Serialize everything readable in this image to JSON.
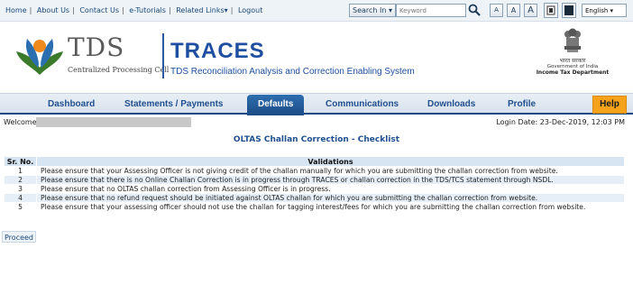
{
  "top_links": [
    "Home",
    "About Us",
    "Contact Us",
    "e-Tutorials",
    "Related Links▾",
    "Logout"
  ],
  "search": {
    "button_label": "Search In ▾",
    "placeholder": "Keyword"
  },
  "font_buttons": [
    "A",
    "A",
    "A"
  ],
  "language": "English ▾",
  "header": {
    "logo_title": "TDS",
    "logo_subtitle": "Centralized Processing Cell",
    "traces_title": "TRACES",
    "traces_subtitle": "TDS Reconciliation Analysis and Correction Enabling System",
    "goi_hindi": "भारत सरकार",
    "goi_line": "Government of India",
    "goi_dept": "Income Tax Department"
  },
  "nav": {
    "items": [
      "Dashboard",
      "Statements / Payments",
      "Defaults",
      "Communications",
      "Downloads",
      "Profile"
    ],
    "active": "Defaults",
    "help": "Help"
  },
  "welcome_label": "Welcome",
  "login_date": "Login Date: 23-Dec-2019, 12:03 PM",
  "page_title": "OLTAS Challan Correction - Checklist",
  "table": {
    "headers": [
      "Sr. No.",
      "Validations"
    ],
    "rows": [
      [
        "1",
        "Please ensure that your Assessing Officer is not giving credit of the challan manually for which you are submitting the challan correction from website."
      ],
      [
        "2",
        "Please ensure that there is no Online Challan Correction is in progress through TRACES or challan correction in the TDS/TCS statement through NSDL."
      ],
      [
        "3",
        "Please ensure that no OLTAS challan correction from Assessing Officer is in progress."
      ],
      [
        "4",
        "Please ensure that no refund request should be initiated against OLTAS challan for which you are submitting the challan correction from website."
      ],
      [
        "5",
        "Please ensure that your assessing officer should not use the challan for tagging interest/fees for which you are submitting the challan correction from website."
      ]
    ]
  },
  "proceed_label": "Proceed",
  "colors": {
    "brand_blue": "#1f4fa0",
    "nav_active": "#1b4a85",
    "help_orange": "#f7a21b"
  }
}
